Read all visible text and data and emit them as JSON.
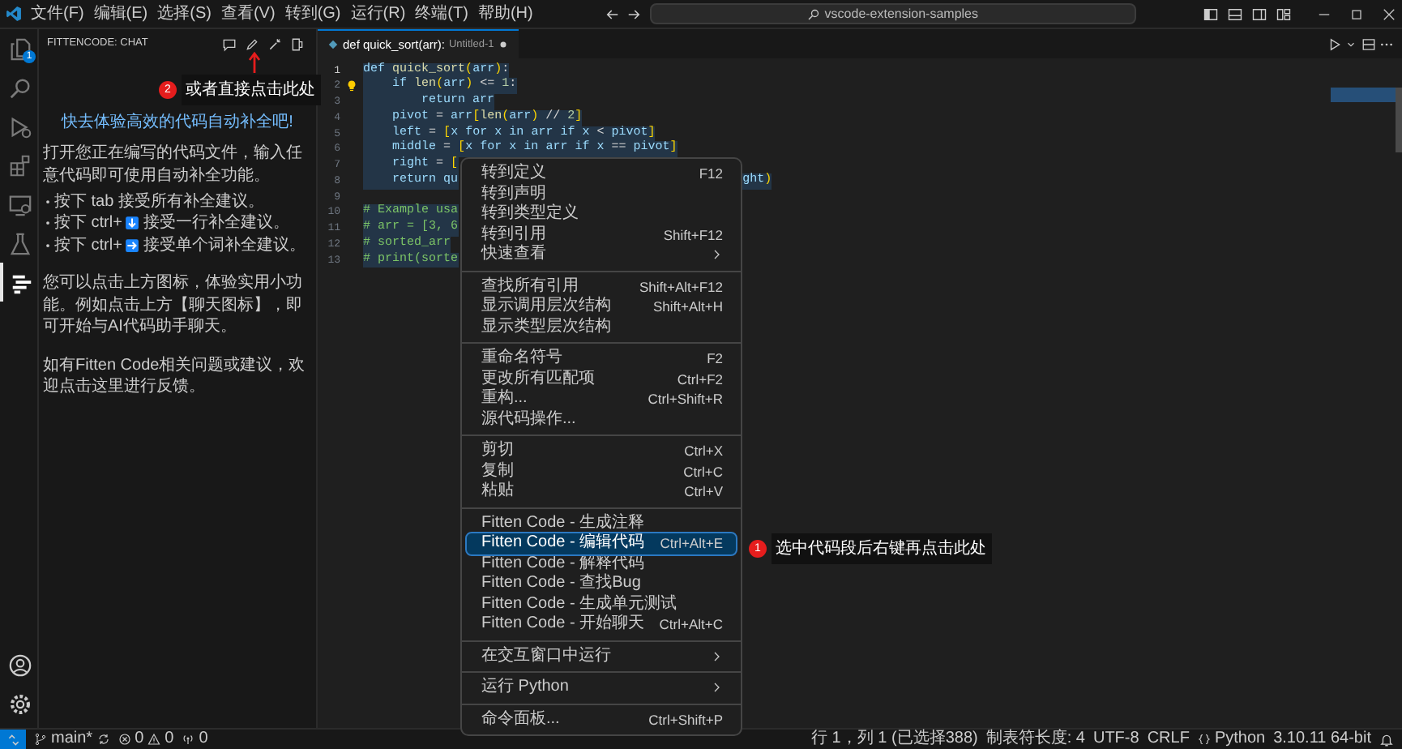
{
  "title_bar": {
    "menus": [
      "文件(F)",
      "编辑(E)",
      "选择(S)",
      "查看(V)",
      "转到(G)",
      "运行(R)",
      "终端(T)",
      "帮助(H)"
    ],
    "search": "vscode-extension-samples"
  },
  "activity_bar": {
    "items": [
      {
        "kind": "explorer",
        "badge": "1",
        "selected": false
      },
      {
        "kind": "search",
        "selected": false
      },
      {
        "kind": "run",
        "selected": false
      },
      {
        "kind": "extensions",
        "selected": false
      },
      {
        "kind": "remote",
        "selected": false
      },
      {
        "kind": "testing",
        "selected": false
      },
      {
        "kind": "chat",
        "selected": true
      }
    ],
    "bottom": [
      {
        "kind": "account"
      },
      {
        "kind": "settings"
      }
    ]
  },
  "sidebar": {
    "title": "FITTENCODE: CHAT",
    "heading": "快去体验高效的代码自动补全吧!",
    "intro": "打开您正在编写的代码文件，输入任意代码即可使用自动补全功能。",
    "tips": [
      {
        "kind": "plain",
        "before": "按下 tab 接受所有补全建议。"
      },
      {
        "kind": "down_key",
        "before": "按下 ctrl+",
        "after": "接受一行补全建议。"
      },
      {
        "kind": "right_key",
        "before": "按下 ctrl+",
        "after": "接受单个词补全建议。"
      }
    ],
    "paragraphs": [
      "您可以点击上方图标，体验实用小功能。例如点击上方【聊天图标】，即可开始与AI代码助手聊天。",
      "如有Fitten Code相关问题或建议，欢迎点击这里进行反馈。"
    ]
  },
  "editor": {
    "tab": {
      "title": "def quick_sort(arr):",
      "file": "Untitled-1",
      "dirty": true
    },
    "lines": [
      {
        "number": "1",
        "text": "def quick_sort(arr):",
        "selected": true
      },
      {
        "number": "2",
        "text": "    if len(arr) <= 1:",
        "selected": true,
        "lightbulb": true
      },
      {
        "number": "3",
        "text": "        return arr",
        "selected": true
      },
      {
        "number": "4",
        "text": "    pivot = arr[len(arr) // 2]",
        "selected": true
      },
      {
        "number": "5",
        "text": "    left = [x for x in arr if x < pivot]",
        "selected": true
      },
      {
        "number": "6",
        "text": "    middle = [x for x in arr if x == pivot]",
        "selected": true
      },
      {
        "number": "7",
        "text": "    right = [",
        "selected": true
      },
      {
        "number": "8",
        "text": "    return qu",
        "tail": "ght)",
        "selected": true
      },
      {
        "number": "9"
      },
      {
        "number": "10",
        "text": "# Example usa",
        "selected": true
      },
      {
        "number": "11",
        "text": "# arr = [3, 6",
        "selected": true
      },
      {
        "number": "12",
        "text": "# sorted_arr",
        "selected": true
      },
      {
        "number": "13",
        "text": "# print(sorte",
        "selected": true
      }
    ]
  },
  "context_menu": {
    "groups": [
      [
        {
          "label": "转到定义",
          "shortcut": "F12",
          "selected": false
        },
        {
          "label": "转到声明",
          "selected": false
        },
        {
          "label": "转到类型定义",
          "selected": false
        },
        {
          "label": "转到引用",
          "shortcut": "Shift+F12",
          "selected": false
        },
        {
          "label": "快速查看",
          "submenu": true,
          "selected": false
        }
      ],
      [
        {
          "label": "查找所有引用",
          "shortcut": "Shift+Alt+F12",
          "selected": false
        },
        {
          "label": "显示调用层次结构",
          "shortcut": "Shift+Alt+H",
          "selected": false
        },
        {
          "label": "显示类型层次结构",
          "selected": false
        }
      ],
      [
        {
          "label": "重命名符号",
          "shortcut": "F2",
          "selected": false
        },
        {
          "label": "更改所有匹配项",
          "shortcut": "Ctrl+F2",
          "selected": false
        },
        {
          "label": "重构...",
          "shortcut": "Ctrl+Shift+R",
          "selected": false
        },
        {
          "label": "源代码操作...",
          "selected": false
        }
      ],
      [
        {
          "label": "剪切",
          "shortcut": "Ctrl+X",
          "selected": false
        },
        {
          "label": "复制",
          "shortcut": "Ctrl+C",
          "selected": false
        },
        {
          "label": "粘贴",
          "shortcut": "Ctrl+V",
          "selected": false
        }
      ],
      [
        {
          "label": "Fitten Code - 生成注释",
          "selected": false
        },
        {
          "label": "Fitten Code - 编辑代码",
          "shortcut": "Ctrl+Alt+E",
          "selected": true
        },
        {
          "label": "Fitten Code - 解释代码",
          "selected": false
        },
        {
          "label": "Fitten Code - 查找Bug",
          "selected": false
        },
        {
          "label": "Fitten Code - 生成单元测试",
          "selected": false
        },
        {
          "label": "Fitten Code - 开始聊天",
          "shortcut": "Ctrl+Alt+C",
          "selected": false
        }
      ],
      [
        {
          "label": "在交互窗口中运行",
          "submenu": true,
          "selected": false
        }
      ],
      [
        {
          "label": "运行 Python",
          "submenu": true,
          "selected": false
        }
      ],
      [
        {
          "label": "命令面板...",
          "shortcut": "Ctrl+Shift+P",
          "selected": false
        }
      ]
    ]
  },
  "annotations": [
    {
      "number": "2",
      "text": "或者直接点击此处",
      "arrow": true
    },
    {
      "number": "1",
      "text": "选中代码段后右键再点击此处"
    }
  ],
  "status_bar": {
    "branch": "main*",
    "errors": "0",
    "warnings": "0",
    "ports": "0",
    "right": [
      {
        "kind": "text",
        "text": "行 1，列 1 (已选择388)"
      },
      {
        "kind": "text",
        "text": "制表符长度: 4"
      },
      {
        "kind": "text",
        "text": "UTF-8"
      },
      {
        "kind": "text",
        "text": "CRLF"
      },
      {
        "kind": "language",
        "text": "Python"
      },
      {
        "kind": "text",
        "text": "3.10.11 64-bit"
      },
      {
        "kind": "bell"
      }
    ]
  }
}
